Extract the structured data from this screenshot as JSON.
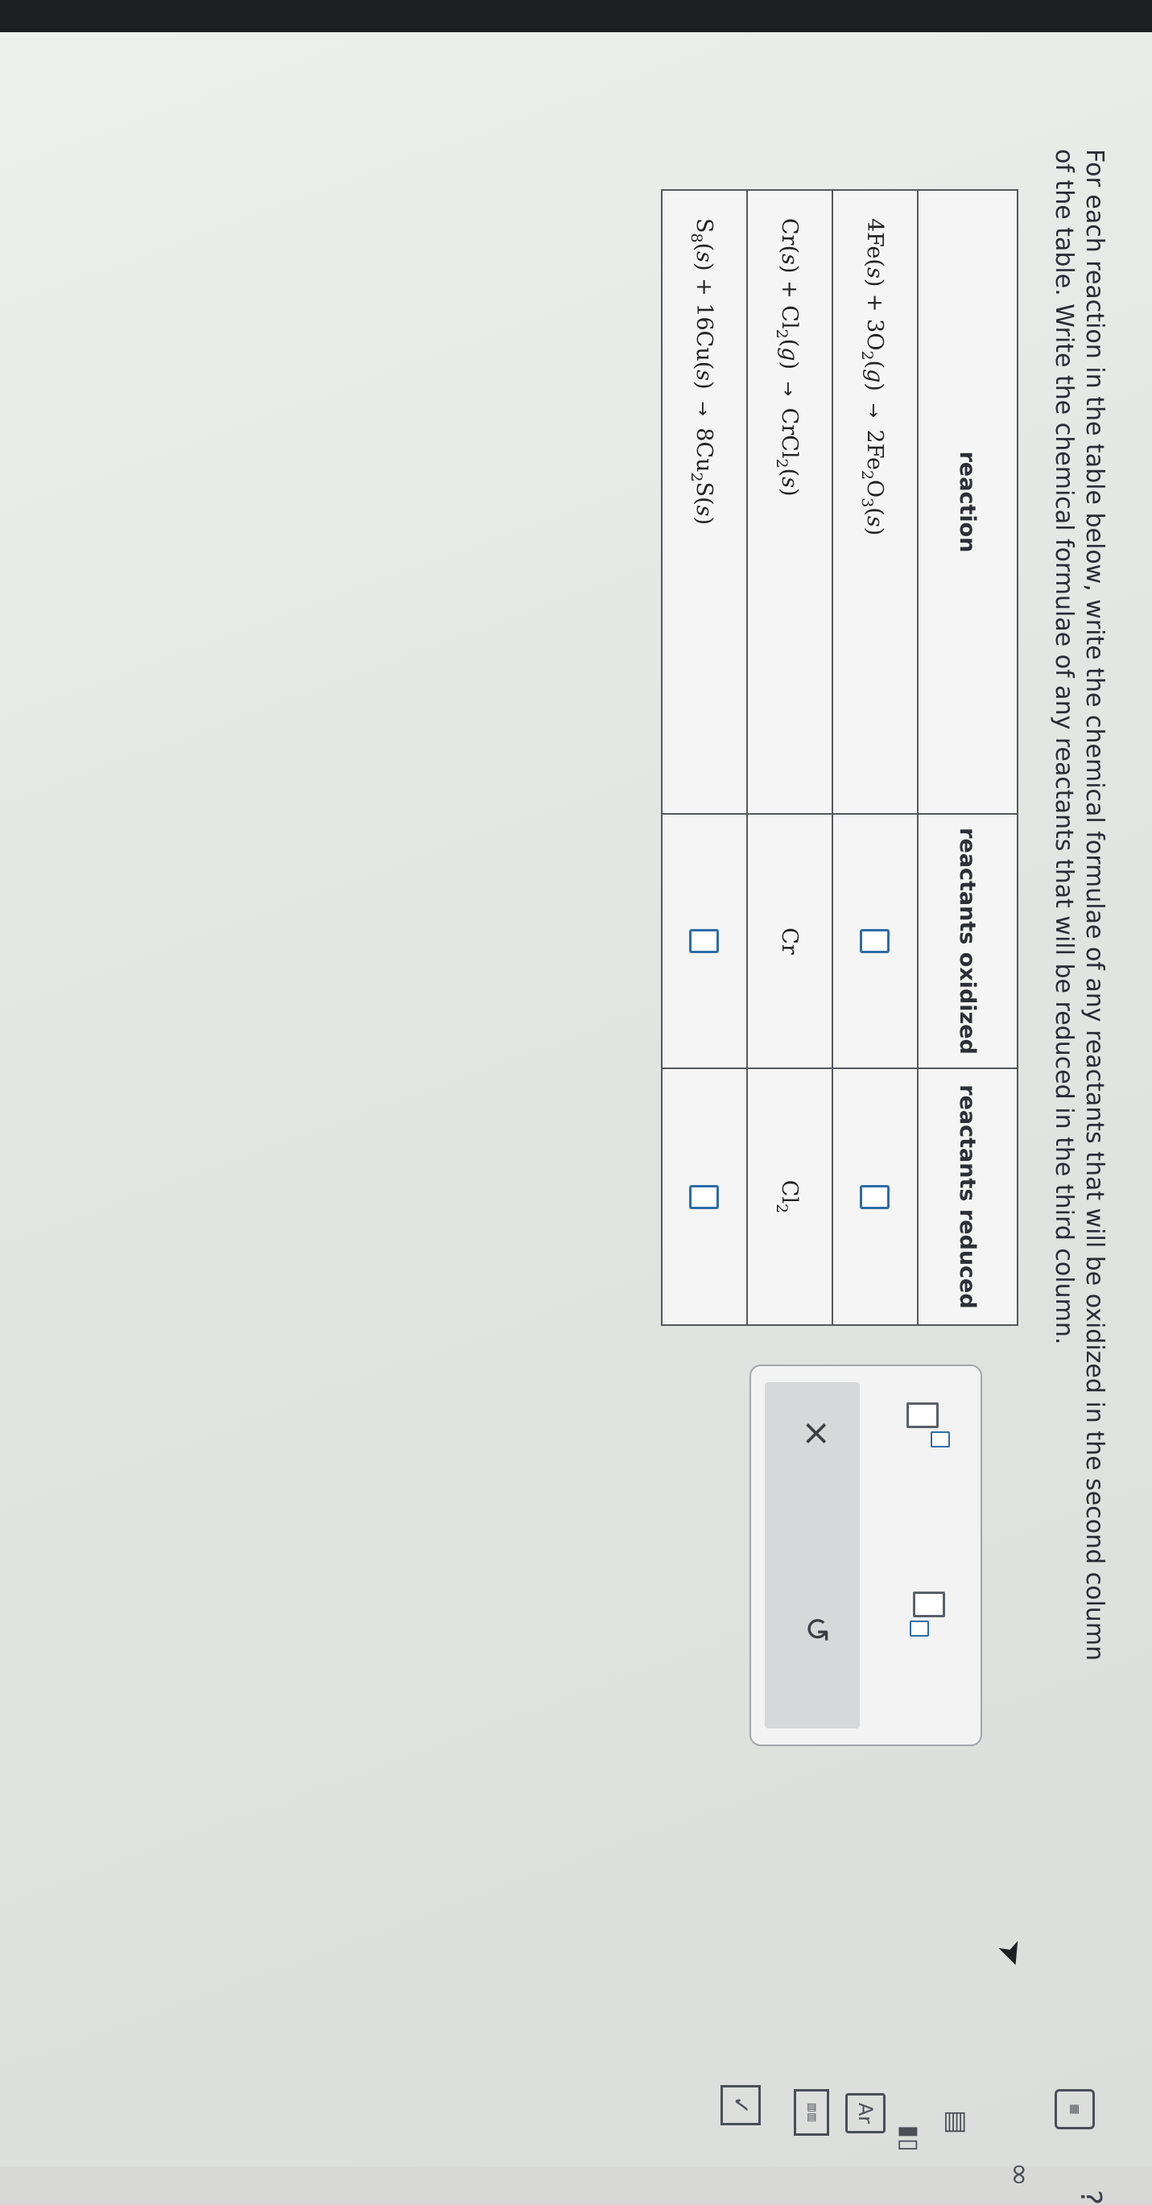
{
  "instructions": {
    "line1": "For each reaction in the table below, write the chemical formulae of any reactants that will be oxidized in the second column",
    "line2": "of the table. Write the chemical formulae of any reactants that will be reduced in the third column."
  },
  "table": {
    "headers": {
      "reaction": "reaction",
      "oxidized": "reactants oxidized",
      "reduced": "reactants reduced"
    },
    "rows": [
      {
        "reaction": "4Fe(s) + 3O2(g) → 2Fe2O3(s)",
        "oxidized": "",
        "reduced": ""
      },
      {
        "reaction": "Cr(s) + Cl2(g) → CrCl2(s)",
        "oxidized": "Cr",
        "reduced": "Cl2"
      },
      {
        "reaction": "S8(s) + 16Cu(s) → 8Cu2S(s)",
        "oxidized": "",
        "reduced": ""
      }
    ]
  },
  "toolbox": {
    "buttons": [
      "superscript",
      "subscript",
      "clear",
      "undo"
    ],
    "clear_glyph": "×",
    "undo_glyph": "↺"
  },
  "sidebar": {
    "help_glyph": "?",
    "icons": [
      "calculator-icon",
      "infinity-icon",
      "book-icon",
      "bar-chart-icon",
      "text-size-icon",
      "periodic-table-icon",
      "check-icon"
    ]
  }
}
